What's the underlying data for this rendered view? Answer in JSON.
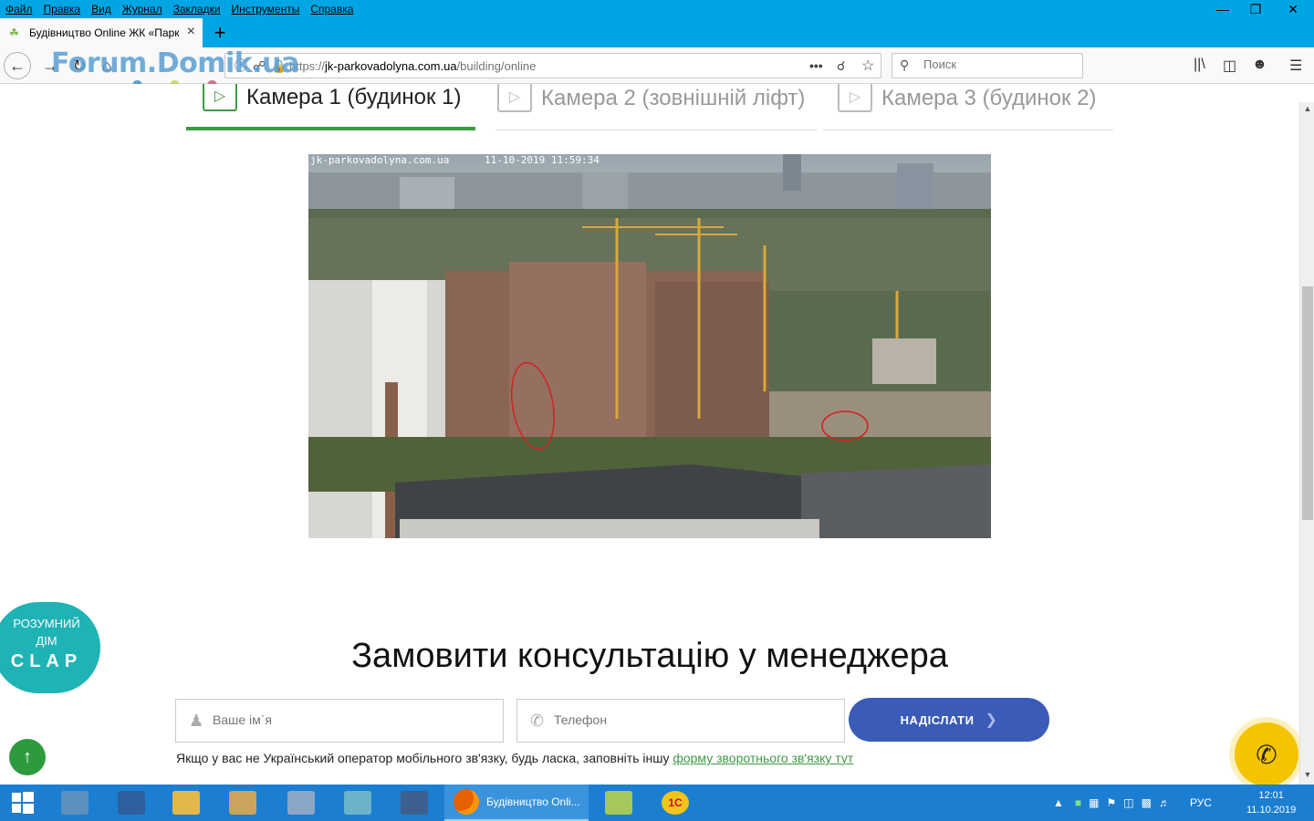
{
  "menubar": {
    "items": [
      "Файл",
      "Правка",
      "Вид",
      "Журнал",
      "Закладки",
      "Инструменты",
      "Справка"
    ]
  },
  "tab": {
    "title": "Будівництво Online ЖК «Парк"
  },
  "navbar": {
    "url_prefix": "https://",
    "url_domain": "jk-parkovadolyna.com.ua",
    "url_path": "/building/online",
    "search_placeholder": "Поиск"
  },
  "watermark": {
    "text": "Forum.Domik.ua"
  },
  "camera_tabs": [
    {
      "label": "Камера 1 (будинок 1)",
      "active": true
    },
    {
      "label": "Камера 2 (зовнішній ліфт)",
      "active": false
    },
    {
      "label": "Камера 3 (будинок 2)",
      "active": false
    }
  ],
  "camera_overlay": {
    "site": "jk-parkovadolyna.com.ua",
    "timestamp": "11-10-2019 11:59:34"
  },
  "clap_widget": {
    "line1": "РОЗУМНИЙ",
    "line2": "ДІМ",
    "brand": "CLAP"
  },
  "consult": {
    "heading": "Замовити консультацію у менеджера",
    "name_placeholder": "Ваше ім`я",
    "phone_placeholder": "Телефон",
    "submit_label": "НАДІСЛАТИ",
    "note_text": "Якщо у вас не Український оператор мобільного зв'язку, будь ласка, заповніть іншу ",
    "note_link": "форму зворотнього зв'язку тут"
  },
  "taskbar": {
    "firefox_label": "Будівництво Onli...",
    "language": "РУС",
    "time": "12:01",
    "date": "11.10.2019"
  },
  "colors": {
    "accent_blue": "#00a6e3",
    "active_green": "#3d9a43",
    "submit_blue": "#3a5bb8",
    "clap_teal": "#1fb3b5",
    "phone_yellow": "#f5c400",
    "taskbar_blue": "#1c7ed0"
  }
}
